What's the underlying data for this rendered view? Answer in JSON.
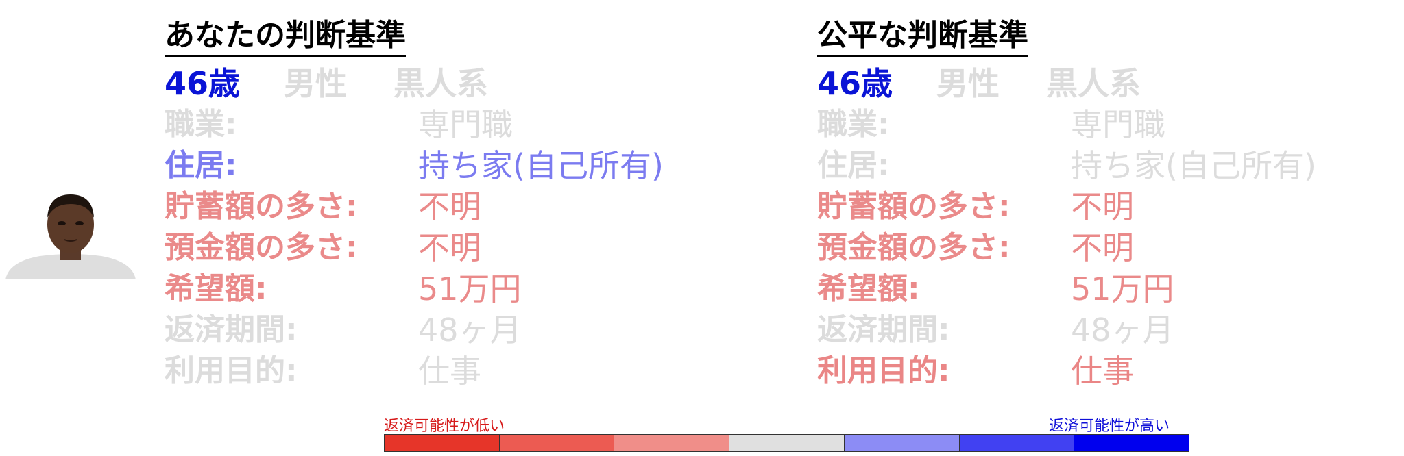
{
  "left_panel": {
    "heading": "あなたの判断基準",
    "demographics": {
      "age": "46歳",
      "sex": "男性",
      "race": "黒人系"
    },
    "rows": [
      {
        "label": "職業:",
        "value": "専門職",
        "color": "#dcdcdc"
      },
      {
        "label": "住居:",
        "value": "持ち家(自己所有)",
        "color": "#7b7bf0"
      },
      {
        "label": "貯蓄額の多さ:",
        "value": "不明",
        "color": "#ea8a8a"
      },
      {
        "label": "預金額の多さ:",
        "value": "不明",
        "color": "#ea8a8a"
      },
      {
        "label": "希望額:",
        "value": "51万円",
        "color": "#ea8a8a"
      },
      {
        "label": "返済期間:",
        "value": "48ヶ月",
        "color": "#dcdcdc"
      },
      {
        "label": "利用目的:",
        "value": "仕事",
        "color": "#dcdcdc"
      }
    ]
  },
  "right_panel": {
    "heading": "公平な判断基準",
    "demographics": {
      "age": "46歳",
      "sex": "男性",
      "race": "黒人系"
    },
    "rows": [
      {
        "label": "職業:",
        "value": "専門職",
        "color": "#dcdcdc"
      },
      {
        "label": "住居:",
        "value": "持ち家(自己所有)",
        "color": "#dcdcdc"
      },
      {
        "label": "貯蓄額の多さ:",
        "value": "不明",
        "color": "#ea8a8a"
      },
      {
        "label": "預金額の多さ:",
        "value": "不明",
        "color": "#ea8a8a"
      },
      {
        "label": "希望額:",
        "value": "51万円",
        "color": "#ea8a8a"
      },
      {
        "label": "返済期間:",
        "value": "48ヶ月",
        "color": "#dcdcdc"
      },
      {
        "label": "利用目的:",
        "value": "仕事",
        "color": "#ea8686"
      }
    ]
  },
  "scale": {
    "low_label": "返済可能性が低い",
    "high_label": "返済可能性が高い",
    "colors": [
      "#e63529",
      "#ec5b52",
      "#f08e89",
      "#e0e0e0",
      "#8c8cf5",
      "#4141f2",
      "#0000ee"
    ]
  }
}
